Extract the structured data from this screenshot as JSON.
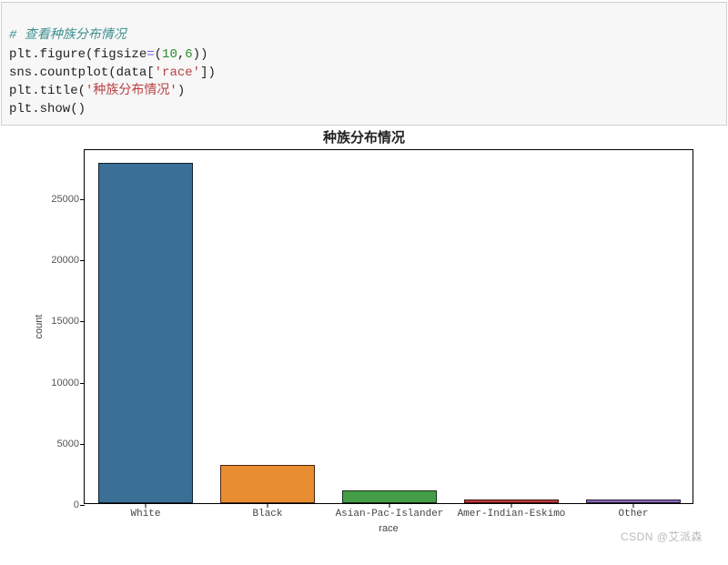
{
  "code": {
    "comment": "# 查看种族分布情况",
    "l2_a": "plt.figure(figsize",
    "l2_eq": "=",
    "l2_p1": "(",
    "l2_n1": "10",
    "l2_comma": ",",
    "l2_n2": "6",
    "l2_p2": "))",
    "l3_a": "sns.countplot(data[",
    "l3_s": "'race'",
    "l3_b": "])",
    "l4_a": "plt.title(",
    "l4_s": "'种族分布情况'",
    "l4_b": ")",
    "l5": "plt.show()"
  },
  "chart_data": {
    "type": "bar",
    "title": "种族分布情况",
    "xlabel": "race",
    "ylabel": "count",
    "categories": [
      "White",
      "Black",
      "Asian-Pac-Islander",
      "Amer-Indian-Eskimo",
      "Other"
    ],
    "values": [
      27800,
      3100,
      1050,
      300,
      280
    ],
    "yticks": [
      0,
      5000,
      10000,
      15000,
      20000,
      25000
    ],
    "ylim": [
      0,
      29000
    ],
    "colors": [
      "#3a6f96",
      "#e88d30",
      "#449e48",
      "#c23a3a",
      "#8668b7"
    ]
  },
  "watermark": "CSDN @艾派森"
}
